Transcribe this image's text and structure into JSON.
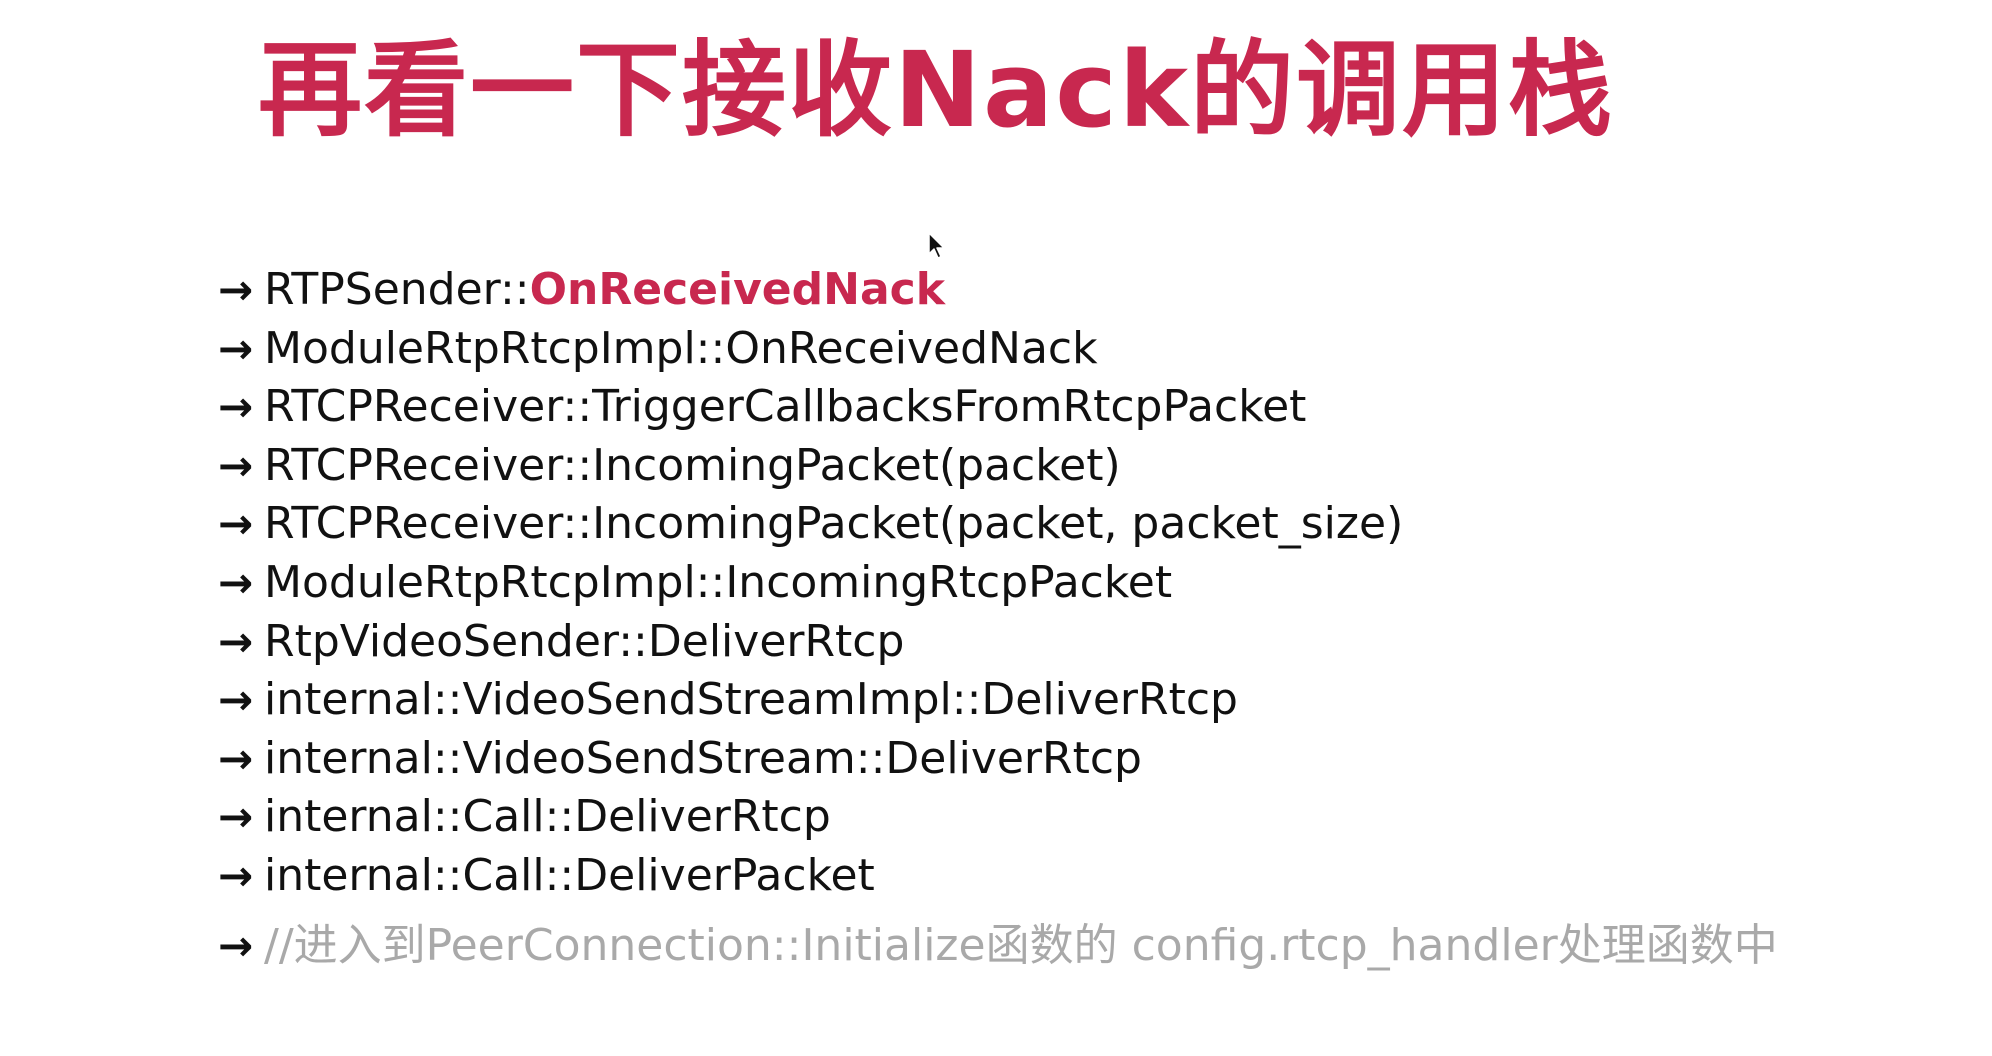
{
  "slide": {
    "title": "再看一下接收Nack的调用栈",
    "arrow_glyph": "→",
    "call_stack": [
      {
        "prefix": "RTPSender::",
        "highlight": "OnReceivedNack"
      },
      {
        "text": "ModuleRtpRtcpImpl::OnReceivedNack"
      },
      {
        "text": "RTCPReceiver::TriggerCallbacksFromRtcpPacket"
      },
      {
        "text": "RTCPReceiver::IncomingPacket(packet)"
      },
      {
        "text": "RTCPReceiver::IncomingPacket(packet, packet_size)"
      },
      {
        "text": "ModuleRtpRtcpImpl::IncomingRtcpPacket"
      },
      {
        "text": "RtpVideoSender::DeliverRtcp"
      },
      {
        "text": "internal::VideoSendStreamImpl::DeliverRtcp"
      },
      {
        "text": "internal::VideoSendStream::DeliverRtcp"
      },
      {
        "text": "internal::Call::DeliverRtcp"
      },
      {
        "text": "internal::Call::DeliverPacket"
      },
      {
        "text": "//进入到PeerConnection::Initialize函数的 config.rtcp_handler处理函数中"
      }
    ]
  },
  "colors": {
    "title": "#c8284f",
    "highlight": "#c8284f",
    "text": "#111111",
    "comment": "#a9a9a9",
    "background": "#ffffff"
  },
  "icons": {
    "pointer": "mouse-pointer-icon"
  }
}
